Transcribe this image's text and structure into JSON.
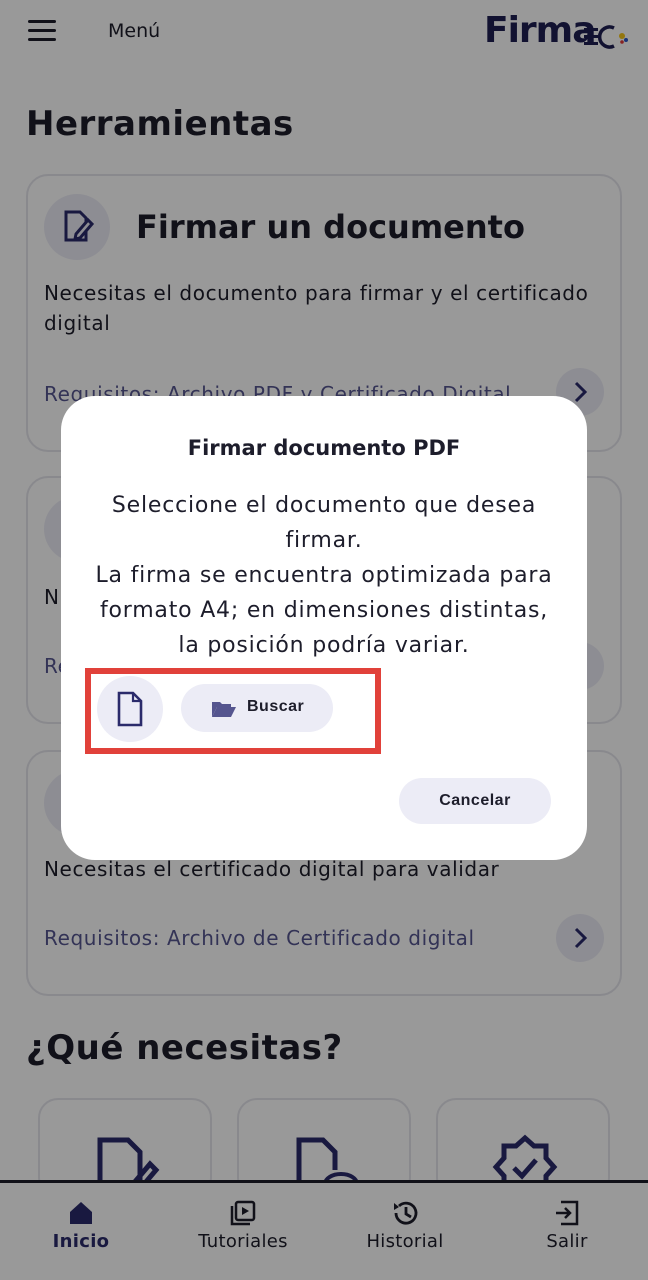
{
  "header": {
    "menu_label": "Menú",
    "logo_text": "Firma"
  },
  "tools": {
    "title": "Herramientas",
    "cards": [
      {
        "title": "Firmar un documento",
        "description": "Necesitas el documento para firmar y el certificado digital",
        "requirements": "Requisitos: Archivo PDF y Certificado Digital"
      },
      {
        "partial_description": "N",
        "partial_requirements": "Re"
      },
      {
        "description": "Necesitas el certificado digital para validar",
        "requirements": "Requisitos: Archivo de Certificado digital"
      }
    ]
  },
  "needs": {
    "title": "¿Qué necesitas?"
  },
  "bottom_nav": {
    "items": [
      {
        "label": "Inicio",
        "icon": "home-icon",
        "active": true
      },
      {
        "label": "Tutoriales",
        "icon": "video-icon"
      },
      {
        "label": "Historial",
        "icon": "history-icon"
      },
      {
        "label": "Salir",
        "icon": "logout-icon"
      }
    ]
  },
  "dialog": {
    "title": "Firmar documento PDF",
    "message_lines": [
      "Seleccione el documento que desea",
      "firmar.",
      "La firma se encuentra optimizada para",
      "formato A4; en dimensiones distintas,",
      "la posición podría variar."
    ],
    "browse_label": "Buscar",
    "cancel_label": "Cancelar"
  },
  "colors": {
    "accent": "#2b2b6b",
    "chip_bg": "#ececf6",
    "highlight": "#e1413a",
    "overlay": "rgba(0,0,0,0.40)"
  }
}
